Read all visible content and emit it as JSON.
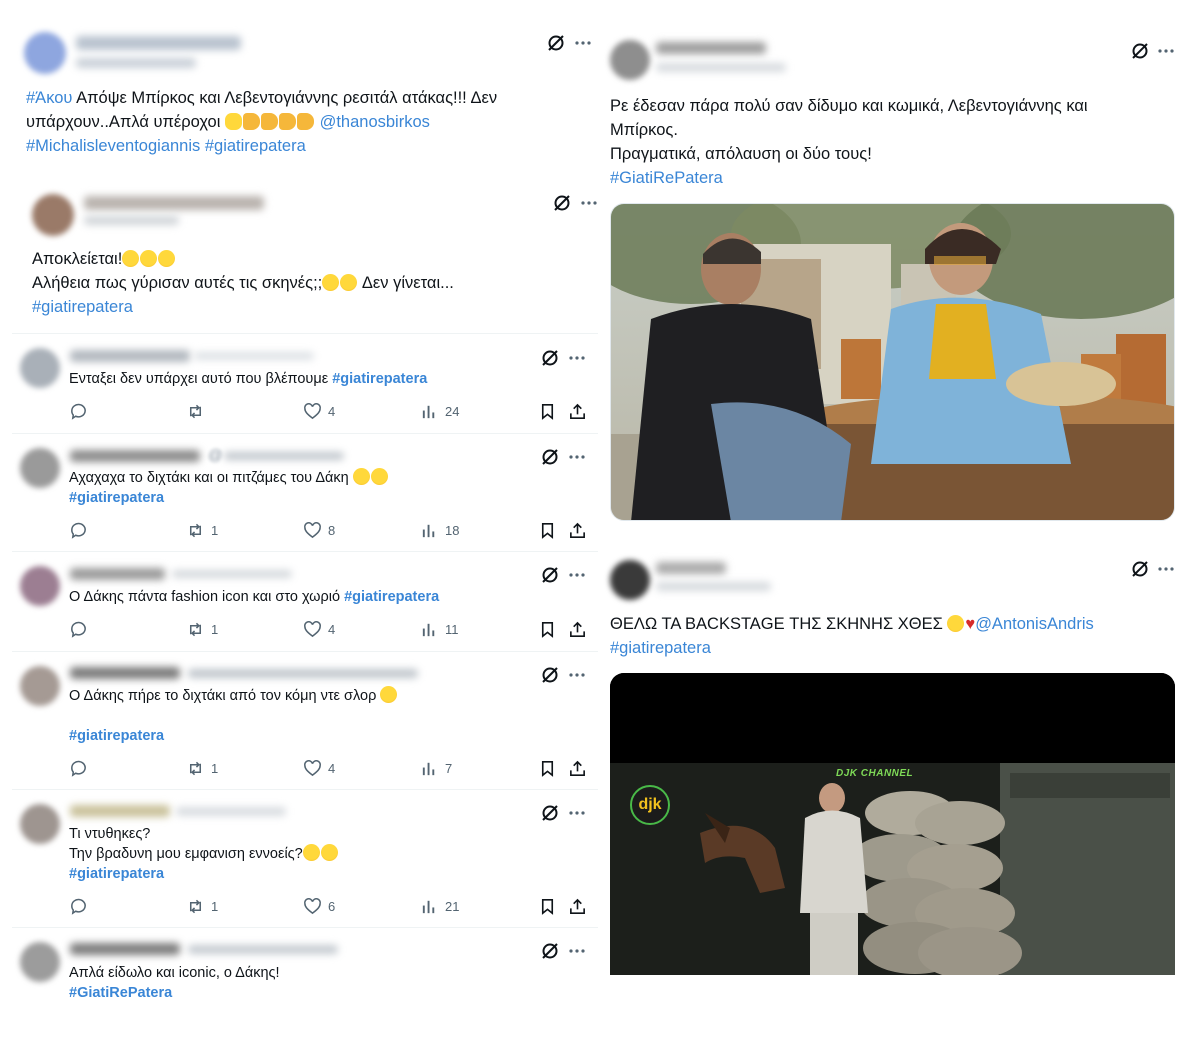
{
  "tweets_left": [
    {
      "line1_pre": "#Άκου",
      "line1_text": " Απόψε Μπίρκος και Λεβεντογιάννης ρεσιτάλ ατάκας!!! Δεν",
      "line2_text": "υπάρχουν..Απλά υπέροχοι ",
      "line2_mention": "@thanosbirkos",
      "line3_tags": "#Michalisleventogiannis #giatirepatera"
    },
    {
      "line1": "Αποκλείεται!",
      "line2_a": "Αλήθεια πως γύρισαν αυτές τις σκηνές;;",
      "line2_b": " Δεν γίνεται...",
      "line3_tag": "#giatirepatera"
    }
  ],
  "replies": [
    {
      "text": "Ενταξει δεν υπάρχει αυτό που βλέπουμε ",
      "tag": "#giatirepatera",
      "retweets": "",
      "likes": "4",
      "views": "24"
    },
    {
      "handle_visible": "@",
      "text": "Αχαχαχα το διχτάκι και οι πιτζάμες του Δάκη ",
      "tag": "#giatirepatera",
      "retweets": "1",
      "likes": "8",
      "views": "18"
    },
    {
      "text": "Ο Δάκης πάντα fashion icon και στο χωριό ",
      "tag": "#giatirepatera",
      "retweets": "1",
      "likes": "4",
      "views": "11"
    },
    {
      "text": "Ο Δάκης πήρε το διχτάκι από τον κόμη ντε σλορ ",
      "tag": "#giatirepatera",
      "retweets": "1",
      "likes": "4",
      "views": "7"
    },
    {
      "text_line1": "Τι ντυθηκες?",
      "text_line2": "Την βραδυνη μου εμφανιση εννοείς?",
      "tag": "#giatirepatera",
      "retweets": "1",
      "likes": "6",
      "views": "21"
    },
    {
      "text": "Απλά είδωλο και iconic, ο Δάκης!",
      "tag": "#GiatiRePatera"
    }
  ],
  "tweets_right": [
    {
      "line1": "Ρε έδεσαν πάρα πολύ σαν δίδυμο και κωμικά, Λεβεντογιάννης και",
      "line2": "Μπίρκος.",
      "line3": "Πραγματικά, απόλαυση οι δύο τους!",
      "line4_tag": "#GiatiRePatera"
    },
    {
      "line1": "ΘΕΛΩ ΤΑ BACKSTAGE ΤΗΣ ΣΚΗΝΗΣ ΧΘΕΣ ",
      "mention": "@AntonisAndris",
      "line2_tag": "#giatirepatera",
      "video_logo": "djk",
      "video_channel": "DJK CHANNEL"
    }
  ],
  "icons": {
    "grok": "grok-slash-icon",
    "more": "more-dots-icon",
    "reply": "reply-icon",
    "retweet": "retweet-icon",
    "like": "heart-icon",
    "views": "views-chart-icon",
    "bookmark": "bookmark-icon",
    "share": "share-icon"
  },
  "colors": {
    "hashtag": "#3a86d6",
    "text": "#0f1419",
    "muted": "#536471"
  }
}
